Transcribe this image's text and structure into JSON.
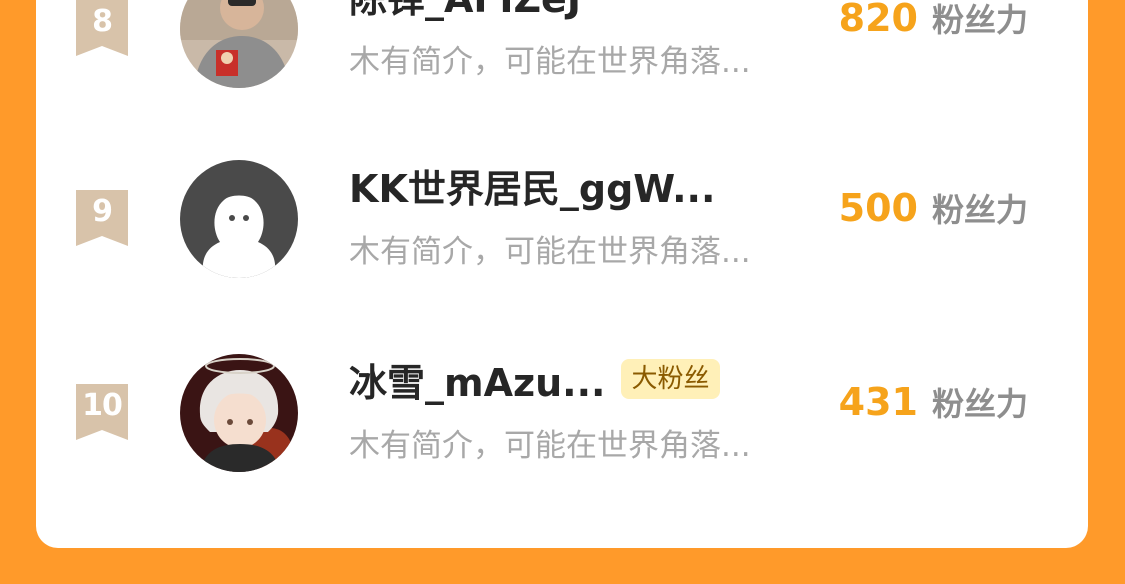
{
  "rows": [
    {
      "rank": "8",
      "name": "陈铎_AFIZeJ",
      "badge": "",
      "bio": "木有简介，可能在世界角落...",
      "score": "820",
      "unit": "粉丝力",
      "avatar": "photo-avatar"
    },
    {
      "rank": "9",
      "name": "KK世界居民_ggW...",
      "badge": "",
      "bio": "木有简介，可能在世界角落...",
      "score": "500",
      "unit": "粉丝力",
      "avatar": "default-avatar"
    },
    {
      "rank": "10",
      "name": "冰雪_mAzu...",
      "badge": "大粉丝",
      "bio": "木有简介，可能在世界角落...",
      "score": "431",
      "unit": "粉丝力",
      "avatar": "anime-avatar"
    }
  ],
  "colors": {
    "background": "#FF9A2A",
    "card": "#FFFFFF",
    "score": "#F6A31B",
    "rank_ribbon": "#D8C3AA",
    "badge_bg": "#FFF0B8"
  }
}
